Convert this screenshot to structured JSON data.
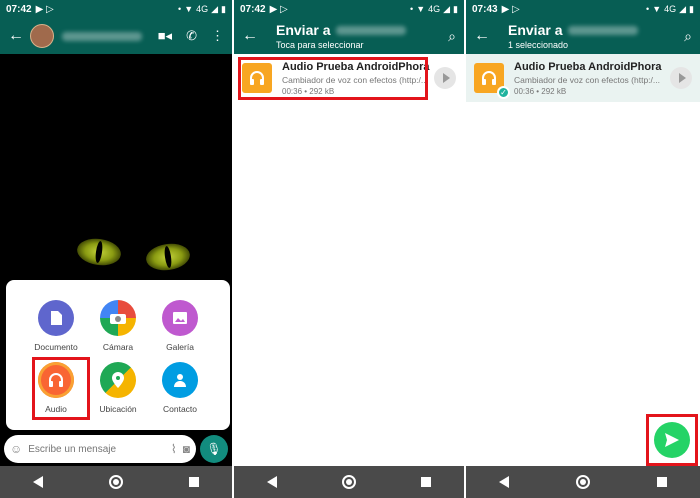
{
  "statusbar": {
    "s1_time": "07:42",
    "s2_time": "07:42",
    "s3_time": "07:43",
    "network": "4G"
  },
  "chat": {
    "attachments": [
      {
        "label": "Documento",
        "color": "#5f66cd"
      },
      {
        "label": "Cámara",
        "color": "#d3396d"
      },
      {
        "label": "Galería",
        "color": "#bf59cf"
      },
      {
        "label": "Audio",
        "color": "#f96533"
      },
      {
        "label": "Ubicación",
        "color": "#1fa855"
      },
      {
        "label": "Contacto",
        "color": "#009de2"
      }
    ],
    "input_placeholder": "Escribe un mensaje"
  },
  "picker": {
    "title": "Enviar a",
    "subtitle_unselected": "Toca para seleccionar",
    "subtitle_selected": "1 seleccionado"
  },
  "file": {
    "name": "Audio Prueba AndroidPhora",
    "description": "Cambiador de voz con efectos (http:/...",
    "meta": "00:36 • 292 kB"
  },
  "colors": {
    "brand": "#075e54",
    "accent": "#25d366",
    "highlight": "#e3141b",
    "file_icon": "#f8a622"
  },
  "icons": {
    "back": "arrow-left-icon",
    "video": "video-camera-icon",
    "call": "phone-icon",
    "more": "more-vert-icon",
    "search": "search-icon",
    "send": "send-icon"
  }
}
